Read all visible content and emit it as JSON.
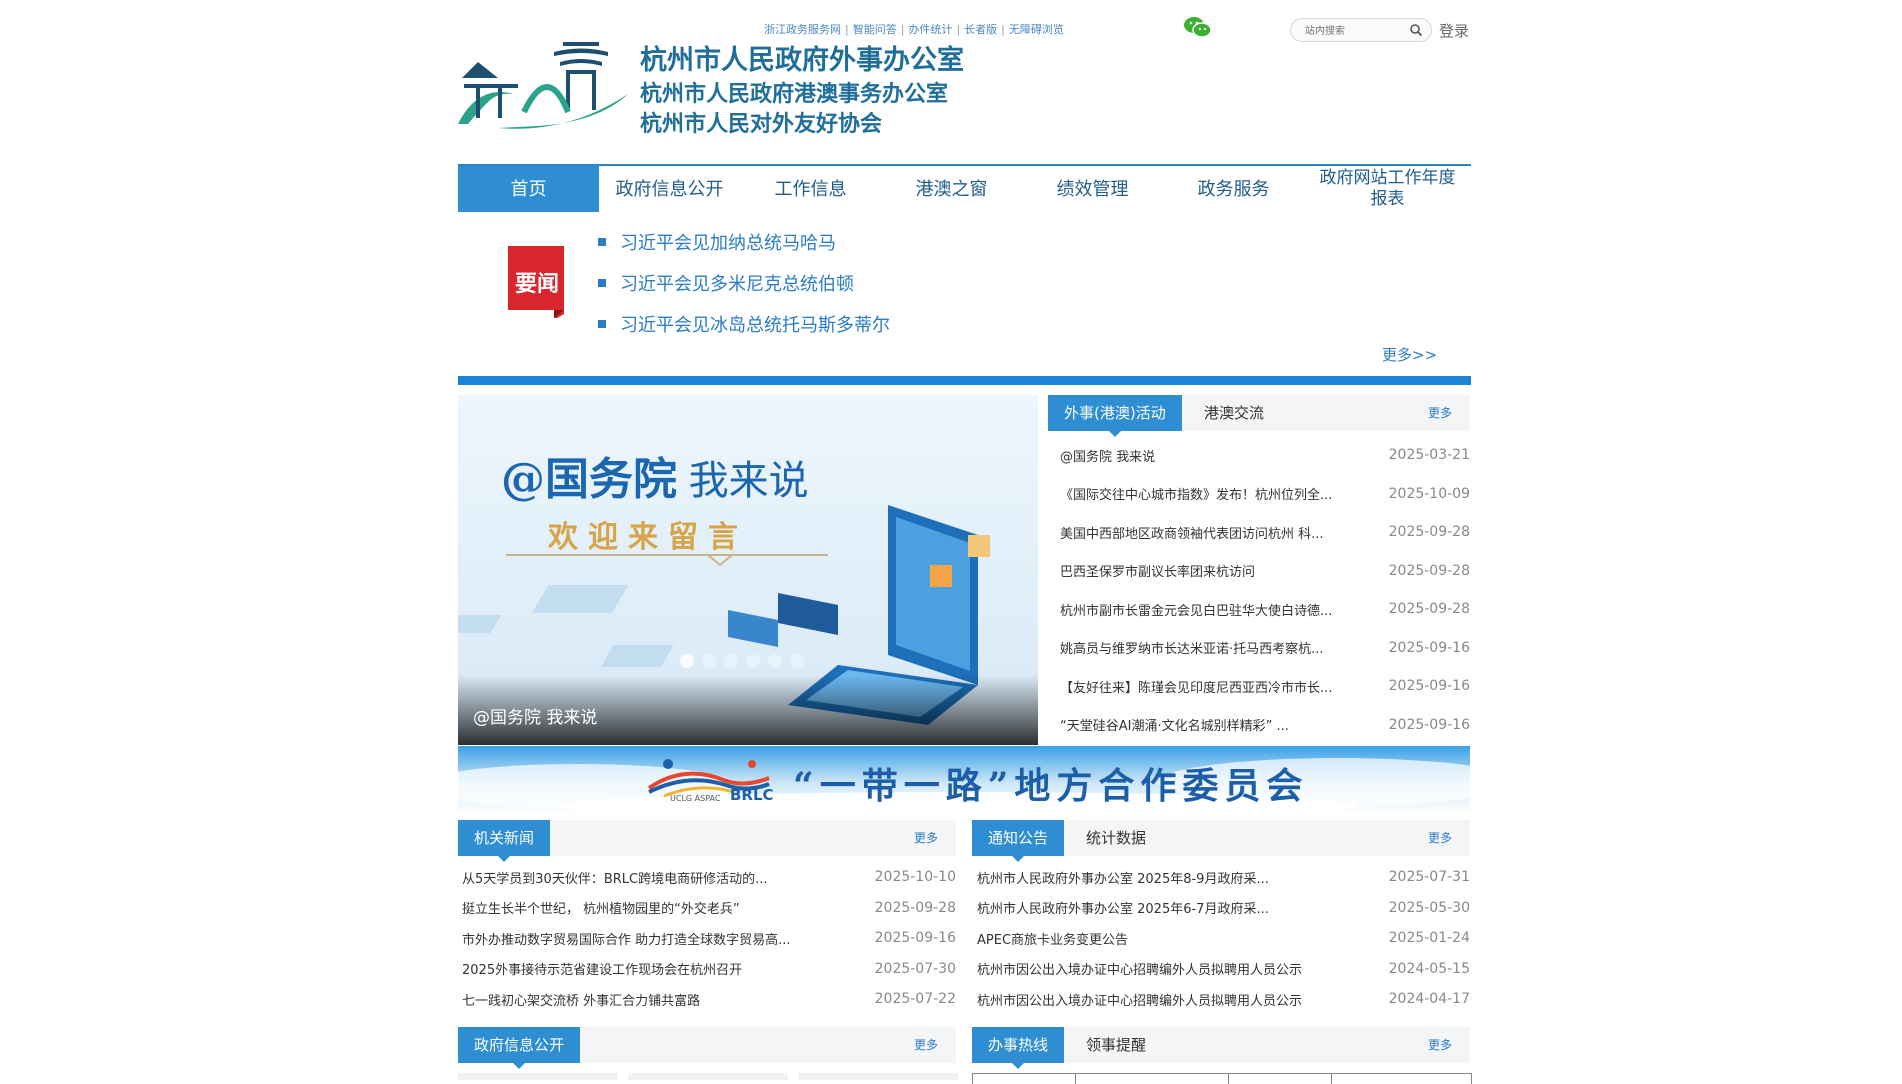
{
  "header": {
    "top_links": [
      "浙江政务服务网",
      "智能问答",
      "办件统计",
      "长者版",
      "无障碍浏览"
    ],
    "search_placeholder": "站内搜索",
    "login": "登录",
    "org_names": [
      "杭州市人民政府外事办公室",
      "杭州市人民政府港澳事务办公室",
      "杭州市人民对外友好协会"
    ]
  },
  "nav": [
    {
      "label": "首页",
      "active": true
    },
    {
      "label": "政府信息公开"
    },
    {
      "label": "工作信息"
    },
    {
      "label": "港澳之窗"
    },
    {
      "label": "绩效管理"
    },
    {
      "label": "政务服务"
    },
    {
      "label": "政府网站工作年度报表"
    }
  ],
  "yaowen": {
    "badge": "要闻",
    "headlines": [
      "习近平会见加纳总统马哈马",
      "习近平会见多米尼克总统伯顿",
      "习近平会见冰岛总统托马斯多蒂尔"
    ],
    "more": "更多>>"
  },
  "banner": {
    "title_at": "@国务院",
    "title_say": "我来说",
    "subtitle": "欢迎来留言",
    "caption": "@国务院 我来说"
  },
  "activities": {
    "tabs": [
      "外事(港澳)活动",
      "港澳交流"
    ],
    "more": "更多",
    "items": [
      {
        "title": "@国务院 我来说",
        "date": "2025-03-21"
      },
      {
        "title": "《国际交往中心城市指数》发布！杭州位列全...",
        "date": "2025-10-09"
      },
      {
        "title": "美国中西部地区政商领袖代表团访问杭州 科...",
        "date": "2025-09-28"
      },
      {
        "title": "巴西圣保罗市副议长率团来杭访问",
        "date": "2025-09-28"
      },
      {
        "title": "杭州市副市长雷金元会见白巴驻华大使白诗德...",
        "date": "2025-09-28"
      },
      {
        "title": "姚高员与维罗纳市长达米亚诺·托马西考察杭...",
        "date": "2025-09-16"
      },
      {
        "title": "【友好往来】陈瑾会见印度尼西亚西冷市市长...",
        "date": "2025-09-16"
      },
      {
        "title": "“天堂硅谷AI潮涌·文化名城别样精彩” ...",
        "date": "2025-09-16"
      }
    ]
  },
  "brlc": {
    "text": "“一带一路”地方合作委员会",
    "logo_text": "BRLC",
    "logo_sub": "UCLG ASPAC"
  },
  "agency_news": {
    "tab": "机关新闻",
    "more": "更多",
    "items": [
      {
        "title": "从5天学员到30天伙伴：BRLC跨境电商研修活动的...",
        "date": "2025-10-10"
      },
      {
        "title": "挺立生长半个世纪， 杭州植物园里的“外交老兵”",
        "date": "2025-09-28"
      },
      {
        "title": "市外办推动数字贸易国际合作 助力打造全球数字贸易高...",
        "date": "2025-09-16"
      },
      {
        "title": "2025外事接待示范省建设工作现场会在杭州召开",
        "date": "2025-07-30"
      },
      {
        "title": "七一践初心架交流桥 外事汇合力铺共富路",
        "date": "2025-07-22"
      }
    ]
  },
  "notices": {
    "tabs": [
      "通知公告",
      "统计数据"
    ],
    "more": "更多",
    "items": [
      {
        "title": "杭州市人民政府外事办公室 2025年8-9月政府采...",
        "date": "2025-07-31"
      },
      {
        "title": "杭州市人民政府外事办公室 2025年6-7月政府采...",
        "date": "2025-05-30"
      },
      {
        "title": "APEC商旅卡业务变更公告",
        "date": "2025-01-24"
      },
      {
        "title": "杭州市因公出入境办证中心招聘编外人员拟聘用人员公示",
        "date": "2024-05-15"
      },
      {
        "title": "杭州市因公出入境办证中心招聘编外人员拟聘用人员公示",
        "date": "2024-04-17"
      }
    ]
  },
  "gov_info": {
    "tab": "政府信息公开",
    "more": "更多"
  },
  "hotline": {
    "tabs": [
      "办事热线",
      "领事提醒"
    ],
    "more": "更多"
  }
}
